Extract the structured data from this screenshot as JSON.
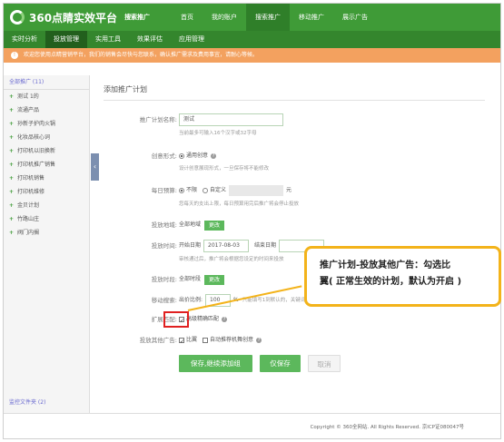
{
  "app": {
    "logo_text": "360点睛实效平台",
    "logo_sub": "搜索推广"
  },
  "topnav": [
    "首页",
    "我的账户",
    "搜索推广",
    "移动推广",
    "展示广告"
  ],
  "topnav_active": 2,
  "subnav": [
    "实时分析",
    "投放管理",
    "实用工具",
    "效果评估",
    "应用管理"
  ],
  "subnav_active": 1,
  "notice": "欢迎您使用点睛营销平台，我们的销售会尽快与您联系，确认推广需求及费用事宜，请耐心等候。",
  "sidebar": {
    "head": "全部推广 (11)",
    "items": [
      "测试 1的",
      "流通产品",
      "孙新子护肉火锅",
      "化妆品核心词",
      "打印机以旧换新",
      "打印机推广销售",
      "打印机销售",
      "打印机维修",
      "金贝计划",
      "竹路山庄",
      "阀门内搁"
    ],
    "footer": "监控文件夹 (2)"
  },
  "main": {
    "title": "添加推广计划",
    "plan_name": {
      "label": "推广计划名称:",
      "value": "测试",
      "hint": "当前最多可输入16个汉字或32字母"
    },
    "creative": {
      "label": "创意形式:",
      "value": "通用创意",
      "hint": "设计创意展现形式，一旦保存将不能修改"
    },
    "budget": {
      "label": "每日预算:",
      "opt_unlimited": "不限",
      "opt_custom": "自定义",
      "unit": "元",
      "hint": "您每天的支出上限，每日预算用完后推广将会停止投放"
    },
    "region": {
      "label": "投放地域:",
      "value": "全部地域",
      "button": "更改"
    },
    "time": {
      "label": "投放时间:",
      "start_label": "开始日期",
      "start_value": "2017-08-03",
      "end_label": "结束日期",
      "hint": "审核通过后，推广将会根据您设定的时间来投放"
    },
    "period": {
      "label": "投放时段:",
      "value": "全部时段",
      "button": "更改"
    },
    "mobile": {
      "label": "移动搜索:",
      "ratio_label": "出价比例:",
      "ratio": "100",
      "percent": "%",
      "hint": "只能填写1到默认的，关键词的搜索"
    },
    "expand": {
      "label": "扩展匹配:",
      "value": "高级精确匹配"
    },
    "other": {
      "label": "投放其他广告:",
      "opt1": "比翼",
      "opt2": "自动推荐机舞创意"
    },
    "buttons": {
      "save_continue": "保存,继续添加组",
      "save": "仅保存",
      "cancel": "取消"
    }
  },
  "footer": "Copyright © 360全网站. All Rights Reserved. 京ICP证080047号",
  "callout": {
    "line1": "推广计划-投放其他广告：勾选比",
    "line2": "翼( 正常生效的计划，默认为开启 )"
  },
  "colors": {
    "brand_green": "#3f9b37",
    "notice_orange": "#f3a15f",
    "callout_border": "#f3b31a",
    "highlight_red": "#e02020"
  }
}
